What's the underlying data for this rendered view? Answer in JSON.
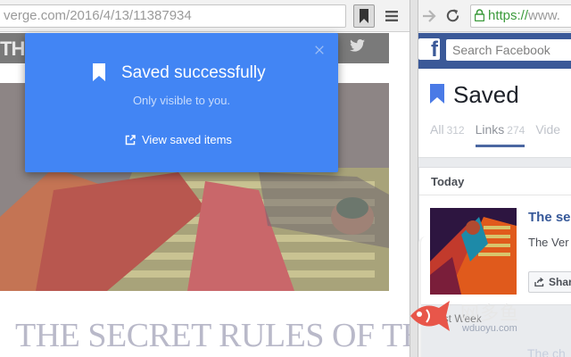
{
  "colors": {
    "popup_bg": "#4285f4",
    "facebook_blue": "#3b5998",
    "link_blue": "#365899",
    "secure_green": "#3c9b3c"
  },
  "left_browser": {
    "url": "verge.com/2016/4/13/11387934",
    "bookmark_icon": "bookmark-icon",
    "menu_icon": "hamburger-menu-icon",
    "site_logo": "TH",
    "twitter_icon": "twitter-icon",
    "article_title": "THE SECRET RULES OF THE"
  },
  "popup": {
    "title": "Saved successfully",
    "subtitle": "Only visible to you.",
    "link_label": "View saved items",
    "close_icon": "close-icon",
    "link_icon": "external-link-icon"
  },
  "right_browser": {
    "forward_icon": "arrow-forward-icon",
    "reload_icon": "reload-icon",
    "url_https": "https://",
    "url_rest": "www.",
    "search_placeholder": "Search Facebook",
    "saved_heading": "Saved",
    "tabs": [
      {
        "label": "All",
        "count": "312"
      },
      {
        "label": "Links",
        "count": "274"
      },
      {
        "label": "Vide",
        "count": ""
      }
    ],
    "today_label": "Today",
    "item_title": "The se",
    "item_source": "The Ver",
    "share_label": "Shar",
    "past_week_label": "Past Week",
    "faded_title": "The ch"
  },
  "watermark": {
    "text": "网多鱼",
    "url": "wduoyu.com"
  }
}
